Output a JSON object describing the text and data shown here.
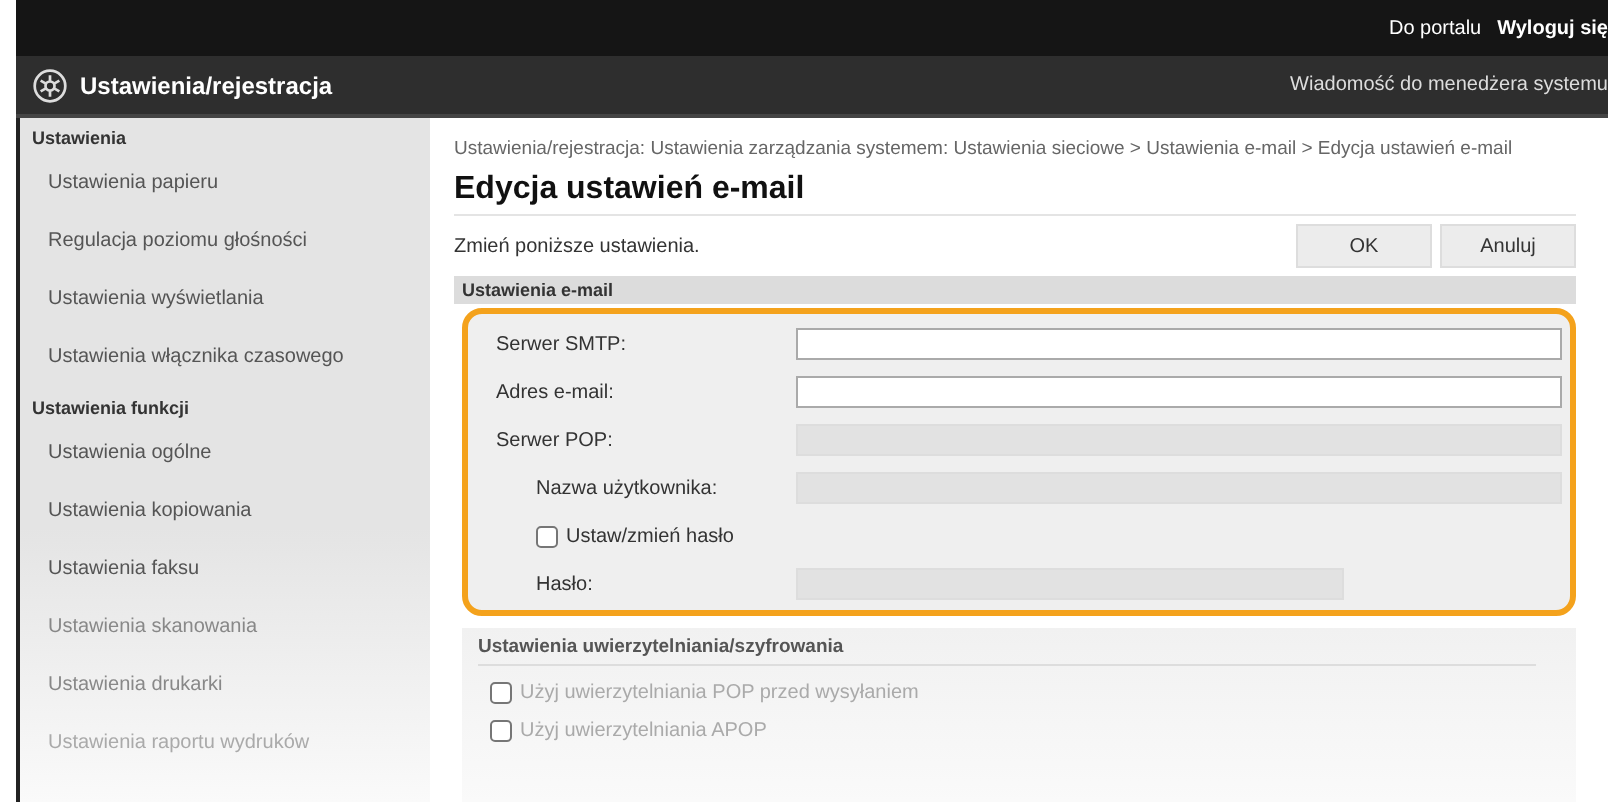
{
  "top_links": [
    {
      "label": "Do portalu"
    },
    {
      "label": "Wyloguj się"
    }
  ],
  "header": {
    "title": "Ustawienia/rejestracja",
    "link": "Wiadomość do menedżera systemu"
  },
  "sidebar": {
    "groups": [
      {
        "title": "Ustawienia",
        "items": [
          {
            "label": "Ustawienia papieru"
          },
          {
            "label": "Regulacja poziomu głośności"
          },
          {
            "label": "Ustawienia wyświetlania"
          },
          {
            "label": "Ustawienia włącznika czasowego"
          }
        ]
      },
      {
        "title": "Ustawienia funkcji",
        "items": [
          {
            "label": "Ustawienia ogólne"
          },
          {
            "label": "Ustawienia kopiowania"
          },
          {
            "label": "Ustawienia faksu"
          },
          {
            "label": "Ustawienia skanowania"
          },
          {
            "label": "Ustawienia drukarki"
          },
          {
            "label": "Ustawienia raportu wydruków"
          }
        ]
      }
    ]
  },
  "breadcrumb": "Ustawienia/rejestracja: Ustawienia zarządzania systemem: Ustawienia sieciowe > Ustawienia e-mail > Edycja ustawień e-mail",
  "page_title": "Edycja ustawień e-mail",
  "instruction": "Zmień poniższe ustawienia.",
  "buttons": [
    "OK",
    "Anuluj"
  ],
  "email_section": {
    "title": "Ustawienia e-mail",
    "highlighted": true,
    "rows": [
      {
        "kind": "field",
        "label": "Serwer SMTP:",
        "disabled": false,
        "indented": false,
        "short": false
      },
      {
        "kind": "field",
        "label": "Adres e-mail:",
        "disabled": false,
        "indented": false,
        "short": false
      },
      {
        "kind": "field",
        "label": "Serwer POP:",
        "disabled": true,
        "indented": false,
        "short": false
      },
      {
        "kind": "field",
        "label": "Nazwa użytkownika:",
        "disabled": true,
        "indented": true,
        "short": false
      },
      {
        "kind": "checkbox",
        "label": "Ustaw/zmień hasło",
        "checked": false,
        "disabled": false
      },
      {
        "kind": "field",
        "label": "Hasło:",
        "disabled": true,
        "indented": true,
        "short": true
      }
    ]
  },
  "auth_section": {
    "title": "Ustawienia uwierzytelniania/szyfrowania",
    "options": [
      {
        "label": "Użyj uwierzytelniania POP przed wysyłaniem",
        "checked": false
      },
      {
        "label": "Użyj uwierzytelniania APOP",
        "checked": false
      }
    ]
  }
}
